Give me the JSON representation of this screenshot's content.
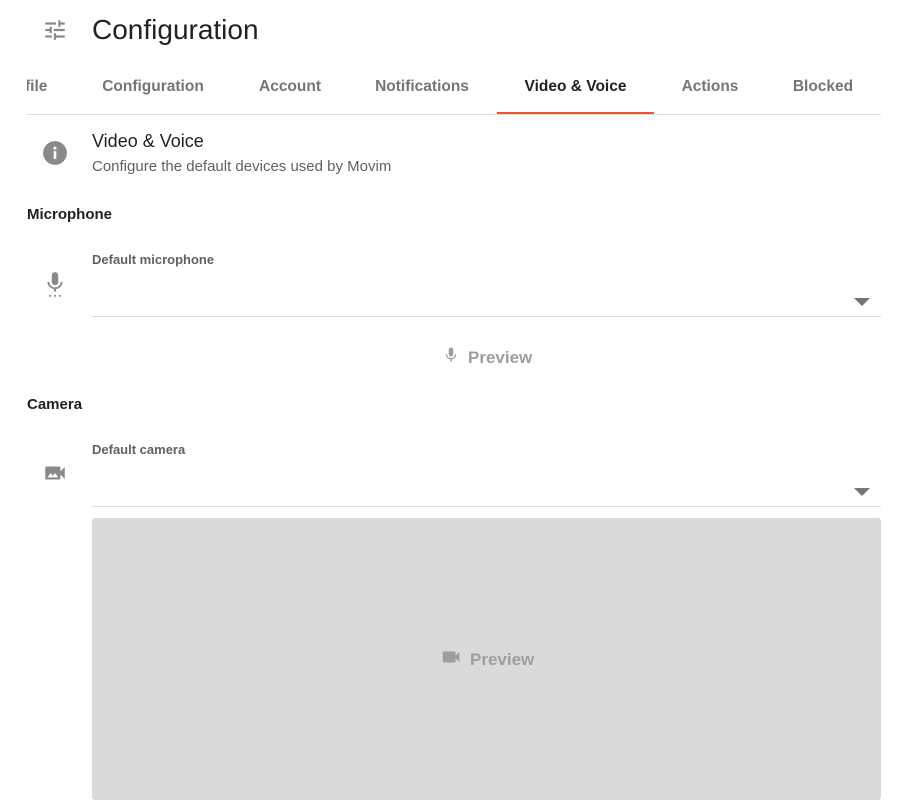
{
  "header": {
    "title": "Configuration",
    "icon": "tune-icon"
  },
  "tabs": [
    {
      "label": "file",
      "active": false
    },
    {
      "label": "Configuration",
      "active": false
    },
    {
      "label": "Account",
      "active": false
    },
    {
      "label": "Notifications",
      "active": false
    },
    {
      "label": "Video & Voice",
      "active": true
    },
    {
      "label": "Actions",
      "active": false
    },
    {
      "label": "Blocked",
      "active": false
    }
  ],
  "info": {
    "icon": "info-icon",
    "title": "Video & Voice",
    "subtitle": "Configure the default devices used by Movim"
  },
  "microphone": {
    "heading": "Microphone",
    "icon": "microphone-icon",
    "field_label": "Default microphone",
    "selected": "",
    "preview_label": "Preview"
  },
  "camera": {
    "heading": "Camera",
    "icon": "video-camera-icon",
    "field_label": "Default camera",
    "selected": "",
    "preview_label": "Preview"
  },
  "colors": {
    "accent": "#e8582c",
    "preview_background": "#dadada",
    "icon_grey": "#757575"
  }
}
